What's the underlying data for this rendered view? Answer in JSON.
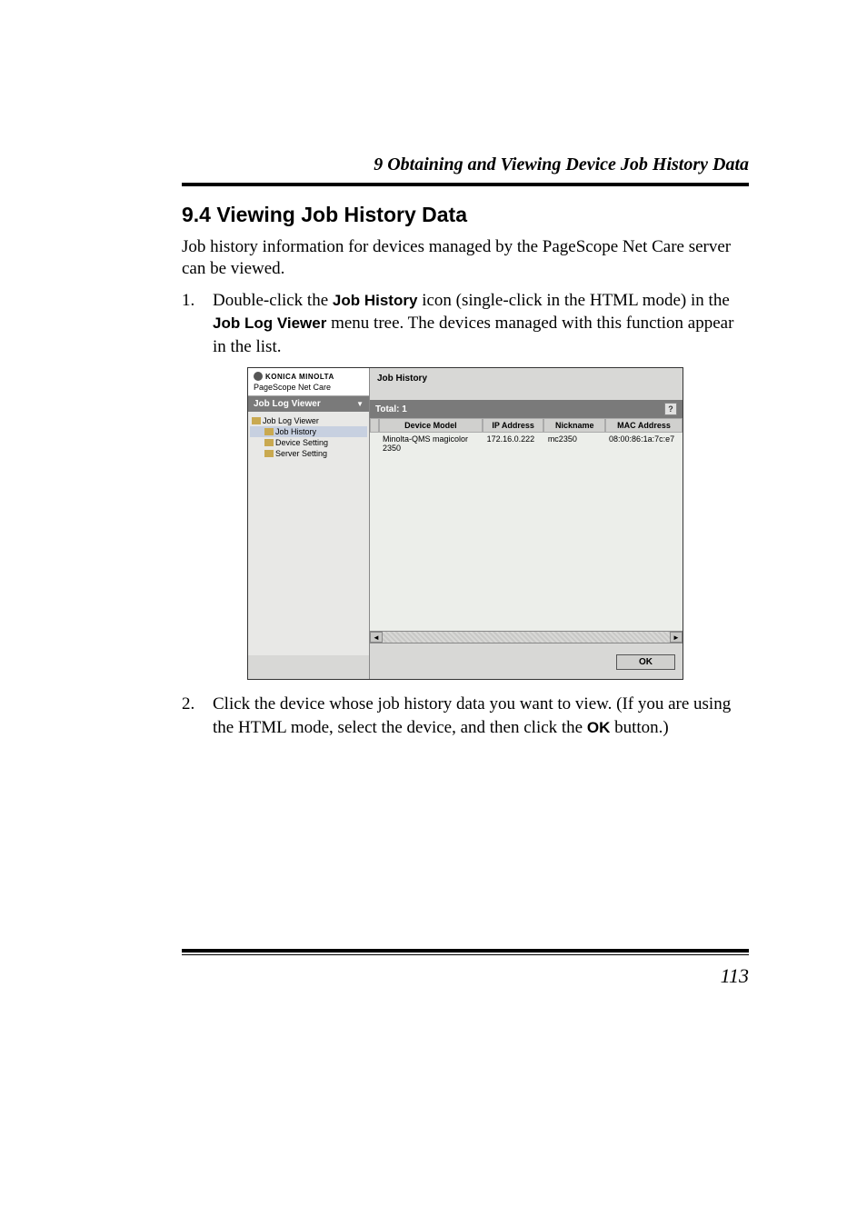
{
  "chapterHeader": "9  Obtaining and Viewing Device Job History Data",
  "sectionTitle": "9.4  Viewing Job History Data",
  "introText": "Job history information for devices managed by the PageScope Net Care server can be viewed.",
  "step1": {
    "num": "1.",
    "pre": "Double-click the ",
    "bold1": "Job History",
    "mid": " icon (single-click in the HTML mode) in the ",
    "bold2": "Job Log Viewer",
    "post": " menu tree. The devices managed with this function appear in the list."
  },
  "step2": {
    "num": "2.",
    "pre": "Click the device whose job history data you want to view. (If you are using the HTML mode, select the device, and then click the ",
    "bold1": "OK",
    "post": " button.)"
  },
  "screenshot": {
    "logo1": "KONICA MINOLTA",
    "logo2": "PageScope Net Care",
    "navTitle": "Job Log Viewer",
    "tree": {
      "root": "Job Log Viewer",
      "children": [
        "Job History",
        "Device Setting",
        "Server Setting"
      ]
    },
    "mainTitle": "Job History",
    "totalLabel": "Total: 1",
    "helpIcon": "?",
    "table": {
      "headers": [
        "",
        "Device Model",
        "IP Address",
        "Nickname",
        "MAC Address"
      ],
      "row": [
        "",
        "Minolta-QMS magicolor 2350",
        "172.16.0.222",
        "mc2350",
        "08:00:86:1a:7c:e7"
      ]
    },
    "scrollLeft": "◄",
    "scrollRight": "►",
    "scrollUp": "▲",
    "scrollDown": "▼",
    "okButton": "OK"
  },
  "pageNumber": "113"
}
